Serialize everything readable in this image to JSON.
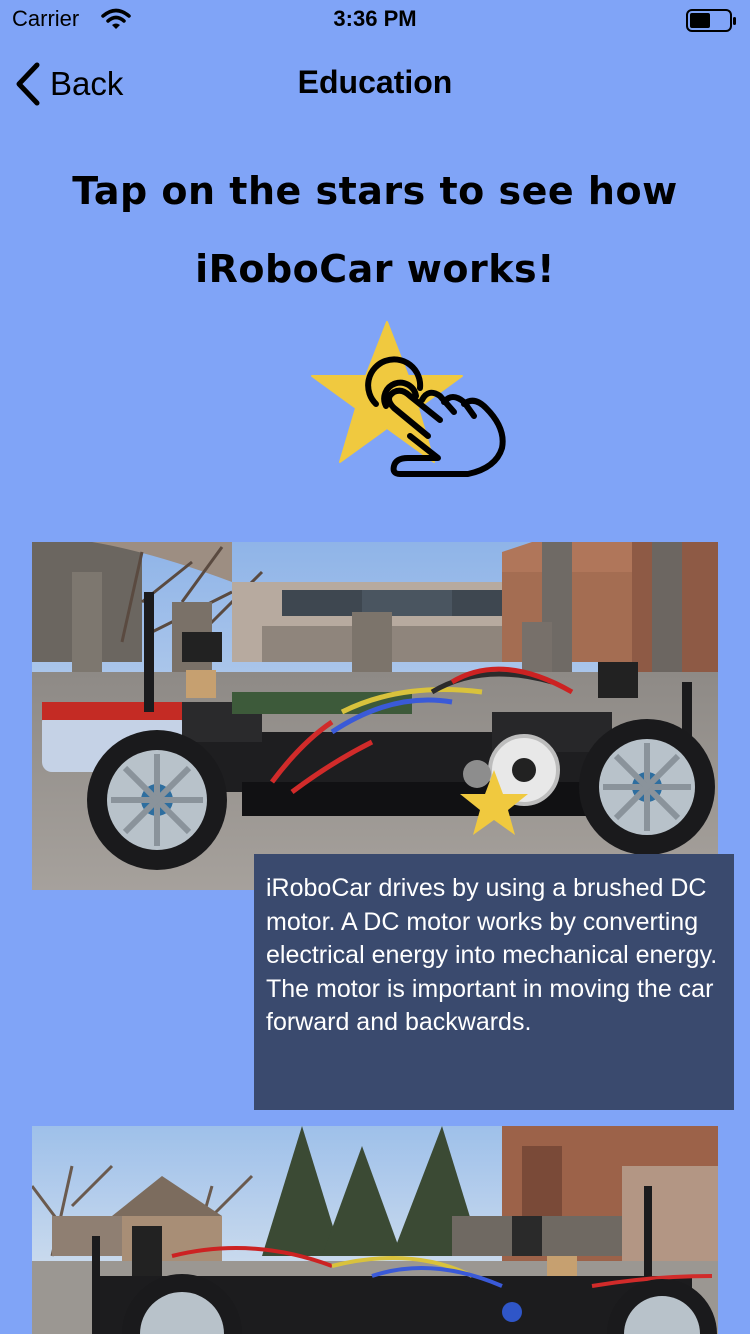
{
  "status_bar": {
    "carrier": "Carrier",
    "time": "3:36 PM",
    "wifi_icon": "wifi-icon",
    "battery_icon": "battery-icon"
  },
  "nav": {
    "back_label": "Back",
    "back_icon": "chevron-left-icon",
    "title": "Education"
  },
  "headline": {
    "line1": "Tap on the stars to see how",
    "line2": "iRoboCar works!"
  },
  "illustration": {
    "icon": "star-tap-icon",
    "star_color": "#f0c93f"
  },
  "photos": [
    {
      "name": "irobocar-side-view-photo"
    },
    {
      "name": "irobocar-front-view-photo"
    }
  ],
  "hotspot": {
    "icon": "star-icon",
    "color": "#f0c93f"
  },
  "info_box": {
    "text": "iRoboCar drives by using a brushed DC motor. A DC motor works by converting electrical energy into mechanical energy. The motor is important in moving the car forward and backwards.",
    "background": "#3a4a6e"
  }
}
